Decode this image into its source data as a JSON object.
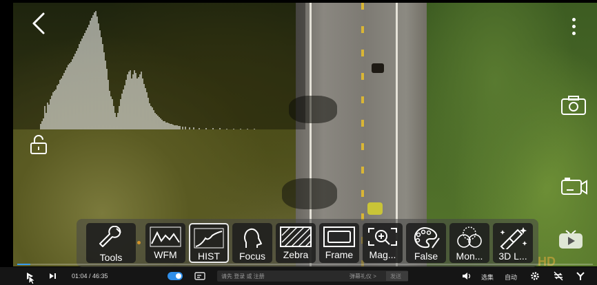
{
  "toolbar": {
    "tools": [
      {
        "label": "Tools",
        "icon": "wrench-icon"
      },
      {
        "label": "WFM",
        "icon": "waveform-icon"
      },
      {
        "label": "HIST",
        "icon": "histogram-icon",
        "selected": true
      },
      {
        "label": "Focus",
        "icon": "focus-icon"
      },
      {
        "label": "Zebra",
        "icon": "zebra-icon"
      },
      {
        "label": "Frame",
        "icon": "frame-icon"
      },
      {
        "label": "Mag...",
        "icon": "magnifier-icon"
      },
      {
        "label": "False",
        "icon": "palette-icon"
      },
      {
        "label": "Mon...",
        "icon": "monochrome-icon"
      },
      {
        "label": "3D L...",
        "icon": "magic-wand-icon"
      }
    ]
  },
  "overlay": {
    "back_icon": "chevron-left-icon",
    "more_icon": "more-vertical-icon",
    "lock_icon": "lock-open-icon",
    "camera_icon": "camera-icon",
    "record_icon": "video-record-icon",
    "logo_icon": "tv-logo-icon",
    "watermark": "HD"
  },
  "player": {
    "time": "01:04 / 46:35",
    "progress": 0.023,
    "danmu_hint": "请先 登录 或 注册",
    "danmu_send": "弹幕礼仪 >",
    "send_label": "发送",
    "select_label": "选集",
    "auto_label": "自动",
    "colors": {
      "accent": "#3a9cf0"
    }
  }
}
